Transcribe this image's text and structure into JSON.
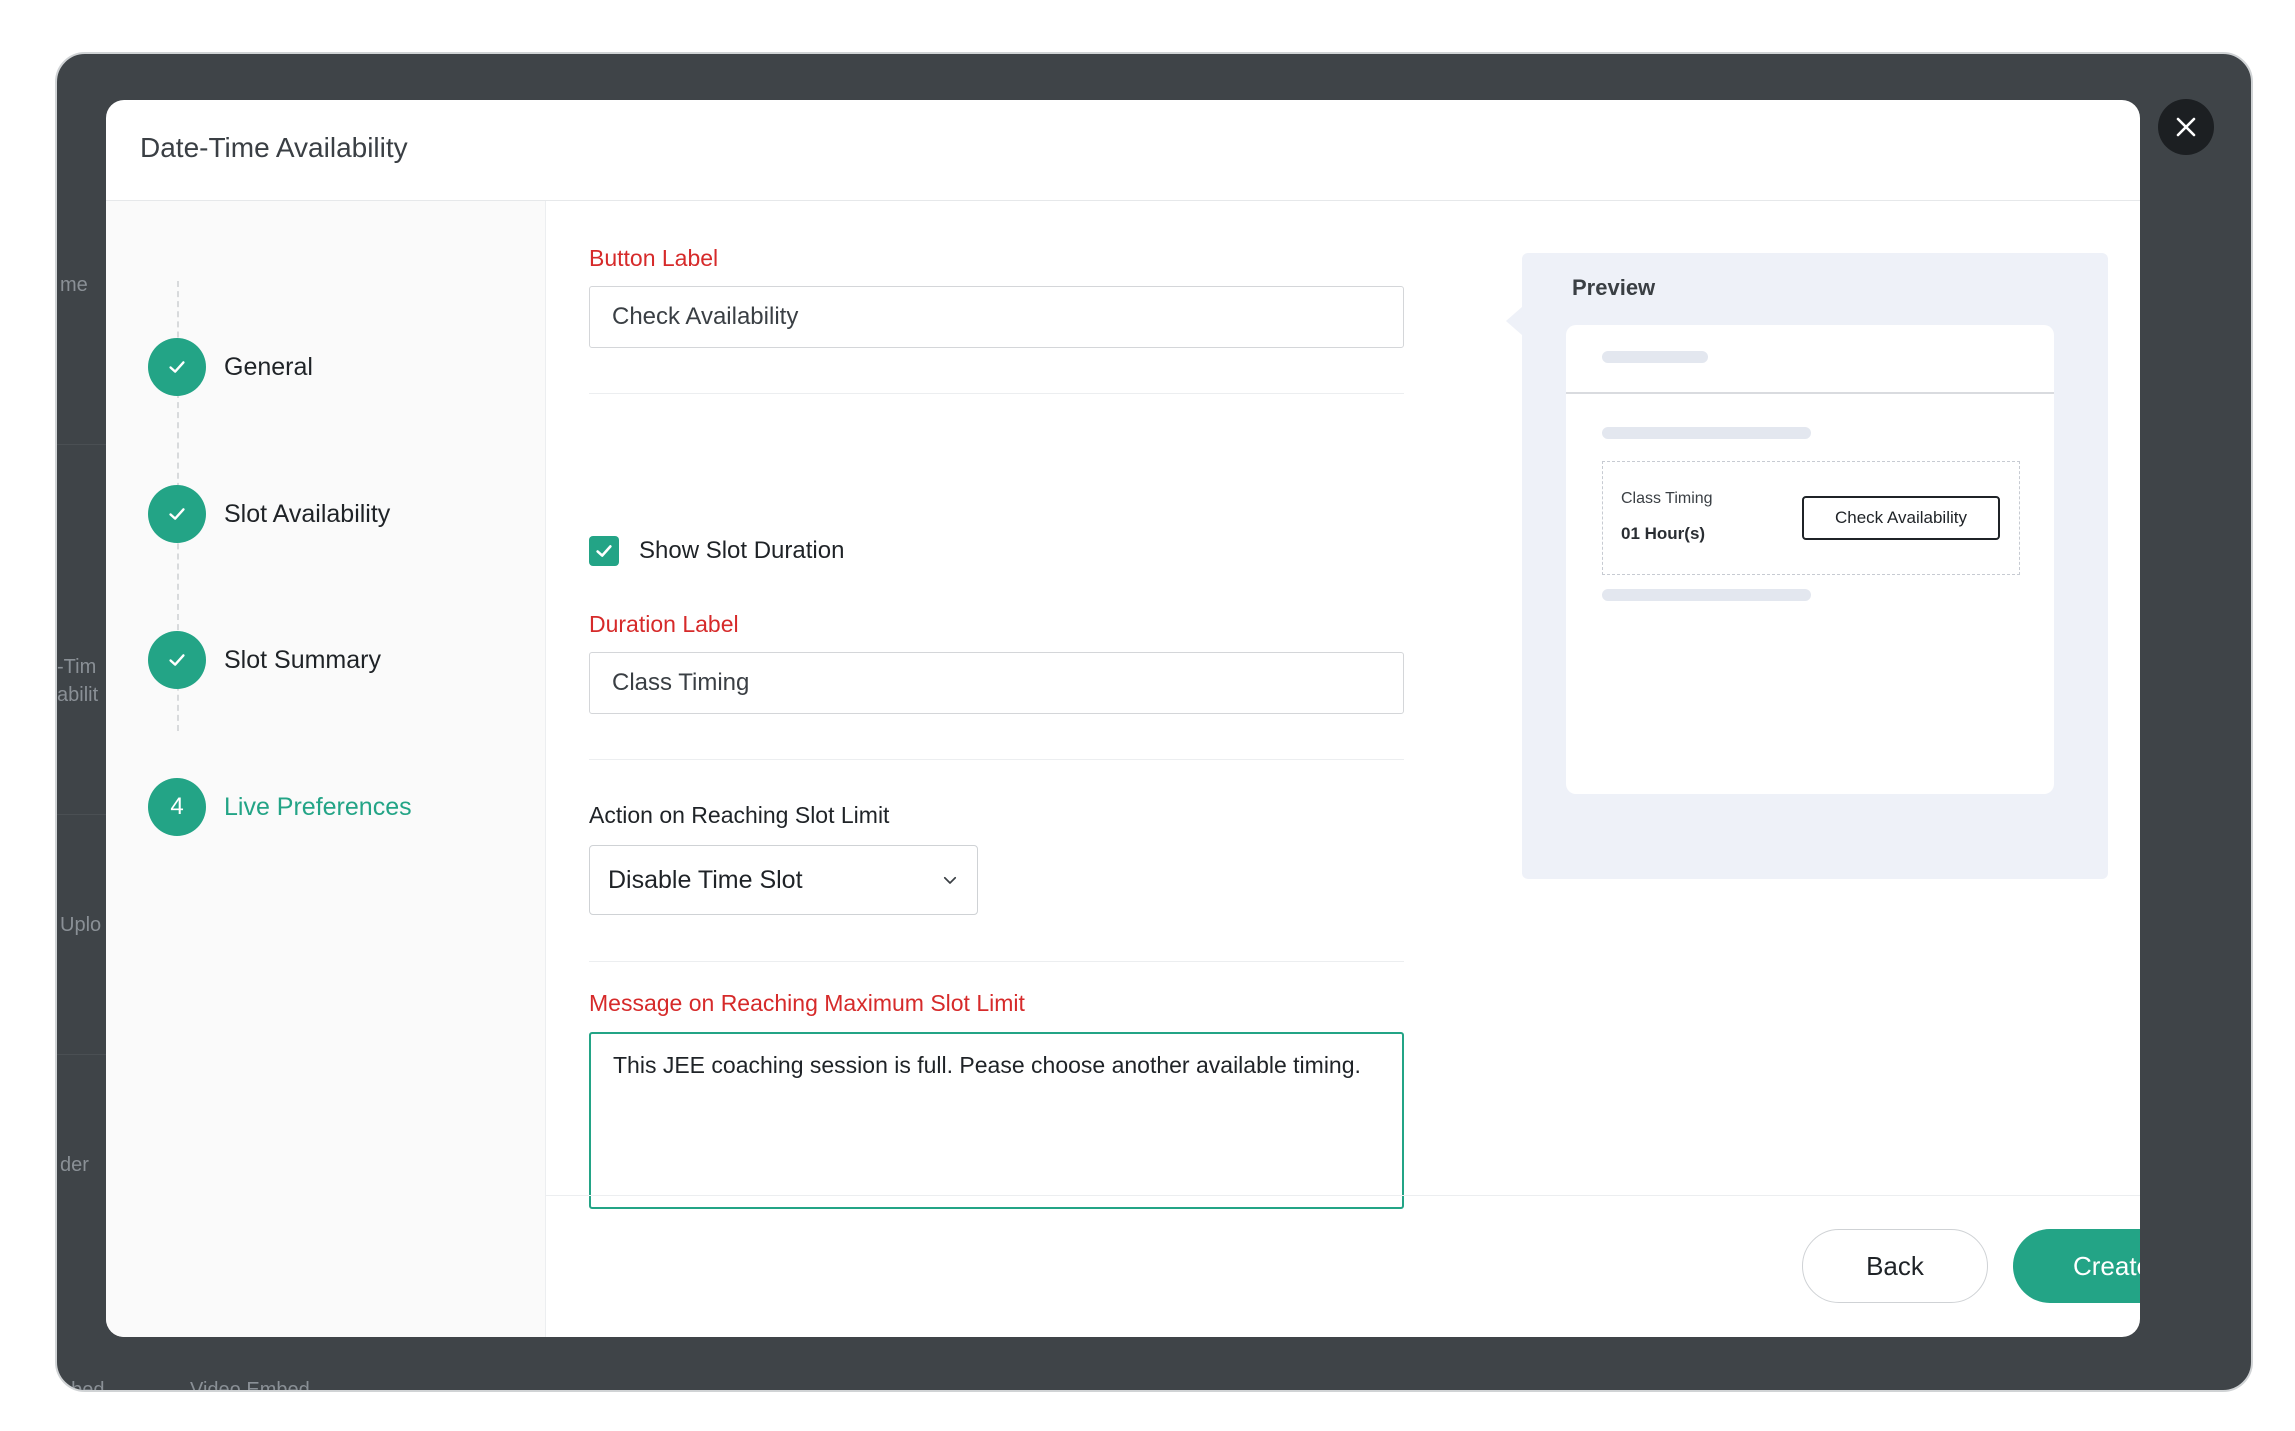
{
  "background_app": {
    "sidebar_fragments": [
      "me",
      "-Tim",
      "abilit",
      "Uplo",
      "der",
      "nbed",
      "Video Embed"
    ]
  },
  "modal": {
    "title": "Date-Time Availability",
    "steps": [
      {
        "label": "General",
        "state": "complete"
      },
      {
        "label": "Slot Availability",
        "state": "complete"
      },
      {
        "label": "Slot Summary",
        "state": "complete"
      },
      {
        "label": "Live Preferences",
        "state": "active",
        "number": "4"
      }
    ]
  },
  "form": {
    "button_label": {
      "label": "Button Label",
      "value": "Check Availability"
    },
    "show_slot_duration": {
      "label": "Show Slot Duration",
      "checked": true
    },
    "duration_label": {
      "label": "Duration Label",
      "value": "Class Timing"
    },
    "slot_limit_action": {
      "label": "Action on Reaching Slot Limit",
      "value": "Disable Time Slot"
    },
    "max_slot_message": {
      "label": "Message on Reaching Maximum Slot Limit",
      "value": "This JEE coaching session is full. Pease choose another available timing."
    }
  },
  "preview": {
    "title": "Preview",
    "slot_label": "Class Timing",
    "slot_value": "01 Hour(s)",
    "button_text": "Check Availability"
  },
  "footer": {
    "back_label": "Back",
    "create_label": "Create"
  },
  "colors": {
    "accent": "#23a486",
    "label_red": "#d62a2a",
    "overlay": "#3f4448"
  }
}
